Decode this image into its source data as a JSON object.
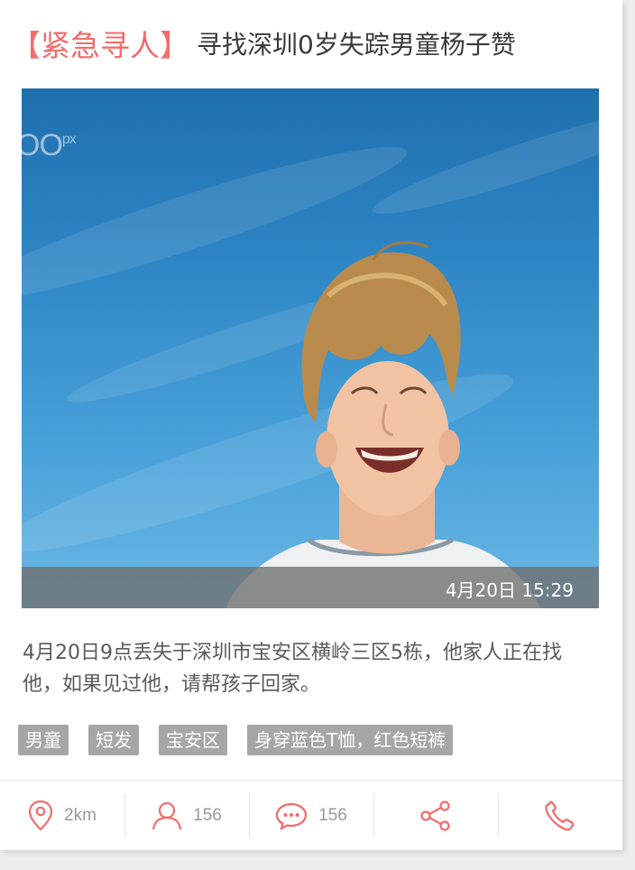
{
  "header": {
    "tag": "【紧急寻人】",
    "title": "寻找深圳0岁失踪男童杨子赞"
  },
  "photo": {
    "watermark_main": "OO",
    "watermark_sup": "px",
    "timestamp": "4月20日 15:29"
  },
  "description": "4月20日9点丢失于深圳市宝安区横岭三区5栋，他家人正在找他，如果见过他，请帮孩子回家。",
  "tags": [
    "男童",
    "短发",
    "宝安区",
    "身穿蓝色T恤，红色短裤"
  ],
  "footer": {
    "distance": "2km",
    "followers": "156",
    "comments": "156"
  },
  "colors": {
    "accent": "#f36b6b",
    "tag_bg": "#a6a6a6",
    "text_dark": "#3a3a3a",
    "text_body": "#5a5a5a"
  },
  "icons": [
    "location-pin-icon",
    "user-icon",
    "comment-bubble-icon",
    "share-icon",
    "phone-icon"
  ]
}
